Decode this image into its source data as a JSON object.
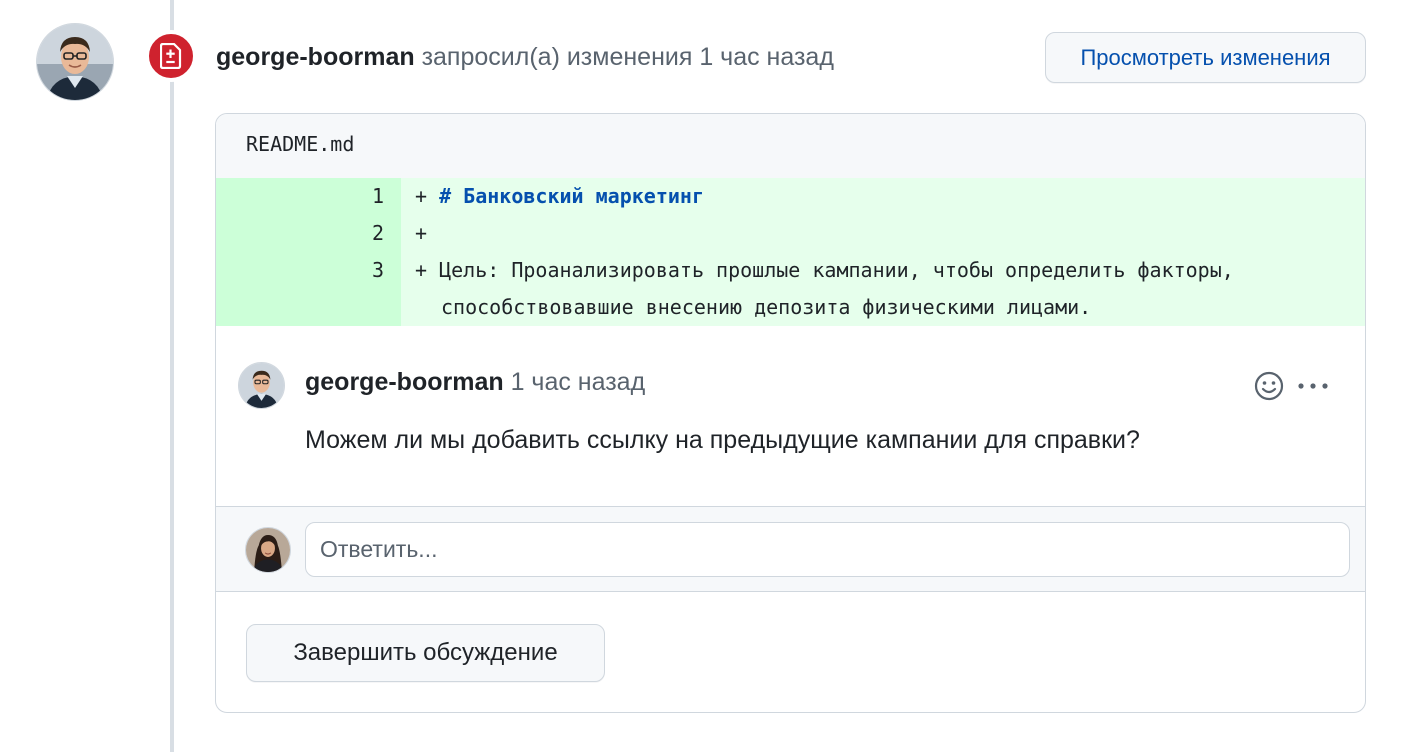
{
  "review": {
    "author": "george-boorman",
    "action": " запросил(а) изменения 1 час назад",
    "view_changes_label": "Просмотреть изменения"
  },
  "file": {
    "name": "README.md",
    "lines": [
      {
        "number": "1",
        "marker": "+ ",
        "text": "# Банковский маркетинг"
      },
      {
        "number": "2",
        "marker": "+",
        "text": ""
      },
      {
        "number": "3",
        "marker": "+ ",
        "text": "Цель: Проанализировать прошлые кампании, чтобы определить факторы,"
      },
      {
        "number": "",
        "marker": "",
        "text": "способствовавшие внесению депозита физическими лицами."
      }
    ]
  },
  "comment": {
    "author": "george-boorman",
    "time": " 1 час назад",
    "body": "Можем ли мы добавить ссылку на предыдущие кампании для справки?"
  },
  "reply": {
    "placeholder": "Ответить..."
  },
  "resolve_label": "Завершить обсуждение",
  "colors": {
    "request_changes_badge": "#cf222e",
    "link_blue": "#0550ae",
    "diff_added_bg": "#e6ffec",
    "diff_added_gutter": "#ccffd8"
  },
  "icons": {
    "badge": "file-diff-icon",
    "reaction": "smiley-icon",
    "menu": "kebab-horizontal-icon"
  }
}
